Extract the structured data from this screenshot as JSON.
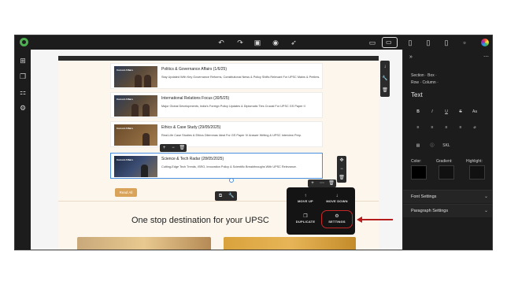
{
  "right_panel": {
    "breadcrumb_line1": "Section · Box ·",
    "breadcrumb_line2": "Row · Column ·",
    "heading": "Text",
    "format_row1": [
      "B",
      "I",
      "U",
      "S",
      "Aa"
    ],
    "format_row2": [
      "≡",
      "≡",
      "≡",
      "≡",
      "⌀"
    ],
    "format_row3": [
      "▤",
      "ⓘ",
      "SKL"
    ],
    "color_label": "Color:",
    "gradient_label": "Gradient:",
    "highlight_label": "Highlight:",
    "sections": [
      {
        "label": "Font Settings"
      },
      {
        "label": "Paragraph Settings"
      }
    ]
  },
  "cards": [
    {
      "title": "Politics & Governance Affairs (1/6/25)",
      "description": "Stay Updated With Key Governance Reforms, Constitutional News & Policy Shifts Relevant For UPSC Mains & Prelims.",
      "thumb_tag": "Current Affairs"
    },
    {
      "title": "International Relations Focus (30/5/25)",
      "description": "Major Global Developments, India's Foreign Policy Updates & Diplomatic Ties Crucial For UPSC GS Paper II",
      "thumb_tag": "Current Affairs"
    },
    {
      "title": "Ethics & Case Study (29/05/2025)",
      "description": "Real-Life Case Studies & Ethics Dilemmas Ideal For GS Paper IV Answer Writing & UPSC Interview Prep.",
      "thumb_tag": "Current Affairs"
    },
    {
      "title": "Science & Tech Radar (28/05/2025)",
      "description": "Cutting-Edge Tech Trends, ISRO, Innovation Policy & Scientific Breakthroughs With UPSC Relevance.",
      "thumb_tag": "Current Affairs"
    }
  ],
  "read_all_label": "Read All",
  "headline": "One stop destination for your UPSC",
  "context_menu": {
    "move_up": "MOVE UP",
    "move_down": "MOVE DOWN",
    "duplicate": "DUPLICATE",
    "settings": "SETTINGS"
  },
  "colors": {
    "accent_red": "#b71c1c",
    "button_gold": "#d9a35a",
    "selection_blue": "#4a90e2"
  }
}
